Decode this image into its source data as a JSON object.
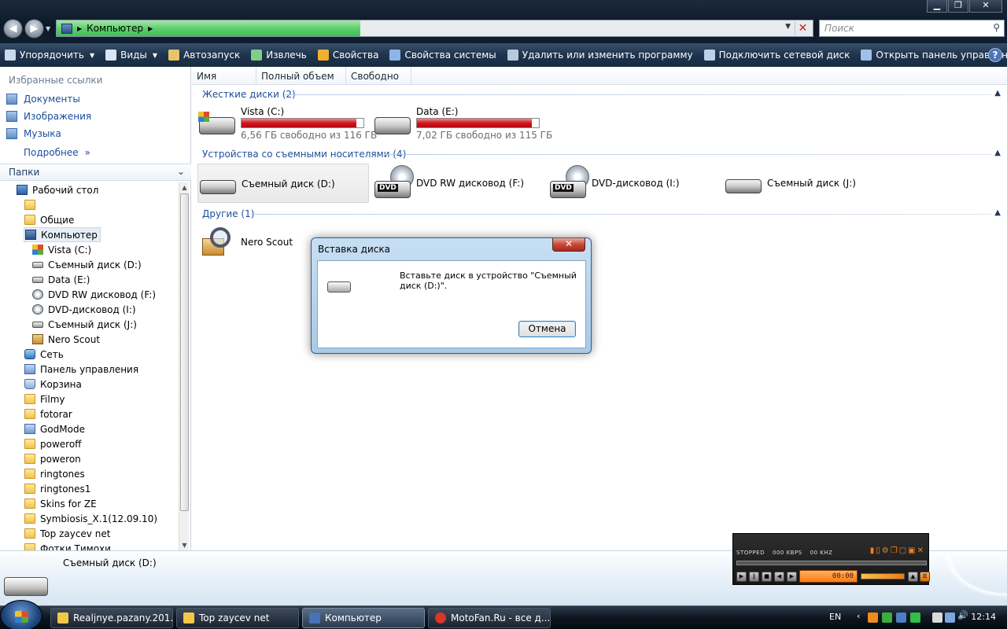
{
  "window": {
    "address_crumb": "Компьютер",
    "search_placeholder": "Поиск",
    "min": "▁",
    "max": "❐",
    "close": "✕"
  },
  "toolbar": {
    "items": [
      {
        "label": "Упорядочить",
        "icon": "organize-icon",
        "dropdown": true
      },
      {
        "label": "Виды",
        "icon": "views-icon",
        "dropdown": true
      },
      {
        "label": "Автозапуск",
        "icon": "autoplay-icon"
      },
      {
        "label": "Извлечь",
        "icon": "eject-icon"
      },
      {
        "label": "Свойства",
        "icon": "properties-icon"
      },
      {
        "label": "Свойства системы",
        "icon": "system-properties-icon"
      },
      {
        "label": "Удалить или изменить программу",
        "icon": "uninstall-icon"
      },
      {
        "label": "Подключить сетевой диск",
        "icon": "map-drive-icon"
      },
      {
        "label": "Открыть панель управления",
        "icon": "control-panel-icon"
      }
    ],
    "help": "?"
  },
  "sidebar": {
    "favorites_title": "Избранные ссылки",
    "favorites": [
      "Документы",
      "Изображения",
      "Музыка"
    ],
    "more": "Подробнее",
    "more_arrow": "»",
    "folders_title": "Папки",
    "folders_chevron": "⌄",
    "tree": [
      {
        "label": "Рабочий стол",
        "icon": "desk",
        "indent": 0
      },
      {
        "label": "",
        "icon": "folder",
        "indent": 1
      },
      {
        "label": "Общие",
        "icon": "folder",
        "indent": 1
      },
      {
        "label": "Компьютер",
        "icon": "comp",
        "indent": 1,
        "selected": true
      },
      {
        "label": "Vista (C:)",
        "icon": "win",
        "indent": 2
      },
      {
        "label": "Съемный диск (D:)",
        "icon": "drive",
        "indent": 2
      },
      {
        "label": "Data (E:)",
        "icon": "drive",
        "indent": 2
      },
      {
        "label": "DVD RW дисковод (F:)",
        "icon": "cd",
        "indent": 2
      },
      {
        "label": "DVD-дисковод (I:)",
        "icon": "cd",
        "indent": 2
      },
      {
        "label": "Съемный диск (J:)",
        "icon": "drive",
        "indent": 2
      },
      {
        "label": "Nero Scout",
        "icon": "house",
        "indent": 2
      },
      {
        "label": "Сеть",
        "icon": "net",
        "indent": 1
      },
      {
        "label": "Панель управления",
        "icon": "cpl",
        "indent": 1
      },
      {
        "label": "Корзина",
        "icon": "bin",
        "indent": 1
      },
      {
        "label": "Filmy",
        "icon": "folder",
        "indent": 1
      },
      {
        "label": "fotorar",
        "icon": "folder",
        "indent": 1
      },
      {
        "label": "GodMode",
        "icon": "cpl",
        "indent": 1
      },
      {
        "label": "poweroff",
        "icon": "folder",
        "indent": 1
      },
      {
        "label": "poweron",
        "icon": "folder",
        "indent": 1
      },
      {
        "label": "ringtones",
        "icon": "folder",
        "indent": 1
      },
      {
        "label": "ringtones1",
        "icon": "folder",
        "indent": 1
      },
      {
        "label": "Skins for ZE",
        "icon": "folder",
        "indent": 1
      },
      {
        "label": "Symbiosis_X.1(12.09.10)",
        "icon": "folder",
        "indent": 1
      },
      {
        "label": "Top zaycev net",
        "icon": "folder",
        "indent": 1
      },
      {
        "label": "Фотки Тимохи",
        "icon": "folder",
        "indent": 1
      }
    ]
  },
  "columns": [
    "Имя",
    "Полный объем",
    "Свободно"
  ],
  "groups": {
    "hard": "Жесткие диски (2)",
    "removable": "Устройства со съемными носителями (4)",
    "other": "Другие (1)"
  },
  "hard_drives": [
    {
      "name": "Vista (C:)",
      "free": "6,56 ГБ свободно из 116 ГБ",
      "used_fraction": 0.94
    },
    {
      "name": "Data (E:)",
      "free": "7,02 ГБ свободно из 115 ГБ",
      "used_fraction": 0.94
    }
  ],
  "removable": [
    {
      "name": "Съемный диск (D:)",
      "dvd": false,
      "selected": true
    },
    {
      "name": "DVD RW дисковод (F:)",
      "dvd": true
    },
    {
      "name": "DVD-дисковод (I:)",
      "dvd": true
    },
    {
      "name": "Съемный диск (J:)",
      "dvd": false
    }
  ],
  "other": [
    {
      "name": "Nero Scout"
    }
  ],
  "dialog": {
    "title": "Вставка диска",
    "message": "Вставьте диск в устройство \"Съемный диск (D:)\".",
    "cancel": "Отмена",
    "close": "✕"
  },
  "details": {
    "name": "Съемный диск (D:)"
  },
  "player": {
    "status": "STOPPED",
    "kbps": "000 KBPS",
    "khz": "00 KHZ",
    "time": "00:00"
  },
  "taskbar": {
    "tasks": [
      {
        "label": "Realjnye.pazany.201..."
      },
      {
        "label": "Top zaycev net"
      },
      {
        "label": "Компьютер",
        "active": true
      },
      {
        "label": "MotoFan.Ru - все д..."
      }
    ],
    "lang": "EN",
    "clock": "12:14"
  }
}
